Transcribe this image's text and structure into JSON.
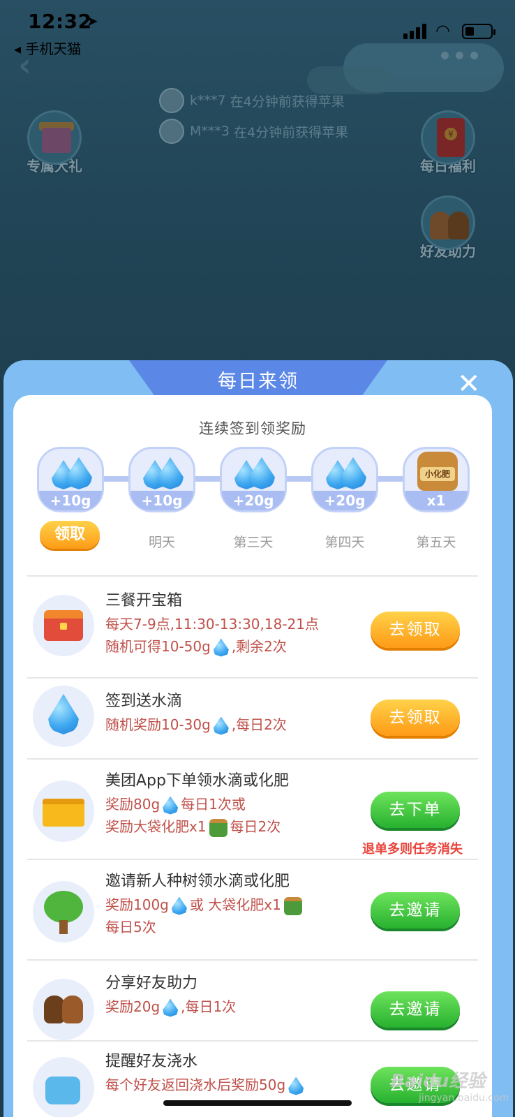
{
  "status_bar": {
    "time": "12:32",
    "back_app": "◂ 手机天猫"
  },
  "ticker": [
    {
      "user": "k***7",
      "text": "在4分钟前获得苹果"
    },
    {
      "user": "M***3",
      "text": "在4分钟前获得苹果"
    }
  ],
  "side_buttons": {
    "gift": "专属大礼",
    "daily_bonus": "每日福利",
    "friend_help": "好友助力"
  },
  "modal": {
    "title": "每日来领",
    "close": "✕",
    "streak_title": "连续签到领奖励",
    "streak": [
      {
        "amount": "+10g",
        "label": "领取",
        "icon": "water-drop-icon"
      },
      {
        "amount": "+10g",
        "label": "明天",
        "icon": "water-drop-icon"
      },
      {
        "amount": "+20g",
        "label": "第三天",
        "icon": "water-drop-icon"
      },
      {
        "amount": "+20g",
        "label": "第四天",
        "icon": "water-drop-icon"
      },
      {
        "amount": "x1",
        "label": "第五天",
        "icon": "fertilizer-sack-icon",
        "sack_text": "小化肥"
      }
    ],
    "tasks": [
      {
        "title": "三餐开宝箱",
        "desc1": "每天7-9点,11:30-13:30,18-21点",
        "desc2a": "随机可得10-50g",
        "desc2b": ",剩余2次",
        "button": "去领取",
        "icon": "treasure-chest-icon"
      },
      {
        "title": "签到送水滴",
        "desc1a": "随机奖励10-30g",
        "desc1b": ",每日2次",
        "button": "去领取",
        "icon": "water-drop-icon"
      },
      {
        "title": "美团App下单领水滴或化肥",
        "desc1a": "奖励80g",
        "desc1b": "每日1次或",
        "desc2a": "奖励大袋化肥x1",
        "desc2b": "每日2次",
        "button": "去下单",
        "note": "退单多则任务消失",
        "icon": "delivery-box-icon"
      },
      {
        "title": "邀请新人种树领水滴或化肥",
        "desc1a": "奖励100g",
        "desc1b": "或 大袋化肥x1",
        "desc2": "每日5次",
        "button": "去邀请",
        "icon": "tree-icon"
      },
      {
        "title": "分享好友助力",
        "desc1a": "奖励20g",
        "desc1b": ",每日1次",
        "button": "去邀请",
        "icon": "friends-icon"
      },
      {
        "title": "提醒好友浇水",
        "desc1a": "每个好友返回浇水后奖励50g",
        "button": "去邀请",
        "icon": "watering-can-icon"
      }
    ]
  },
  "watermark": {
    "main": "Baidu经验",
    "sub": "jingyan.baidu.com"
  },
  "colors": {
    "sheet": "#7fbdf2",
    "tab": "#5b87e6",
    "orange_button": "#ff9c17",
    "green_button": "#27b12f",
    "desc_red": "#c0504a"
  }
}
